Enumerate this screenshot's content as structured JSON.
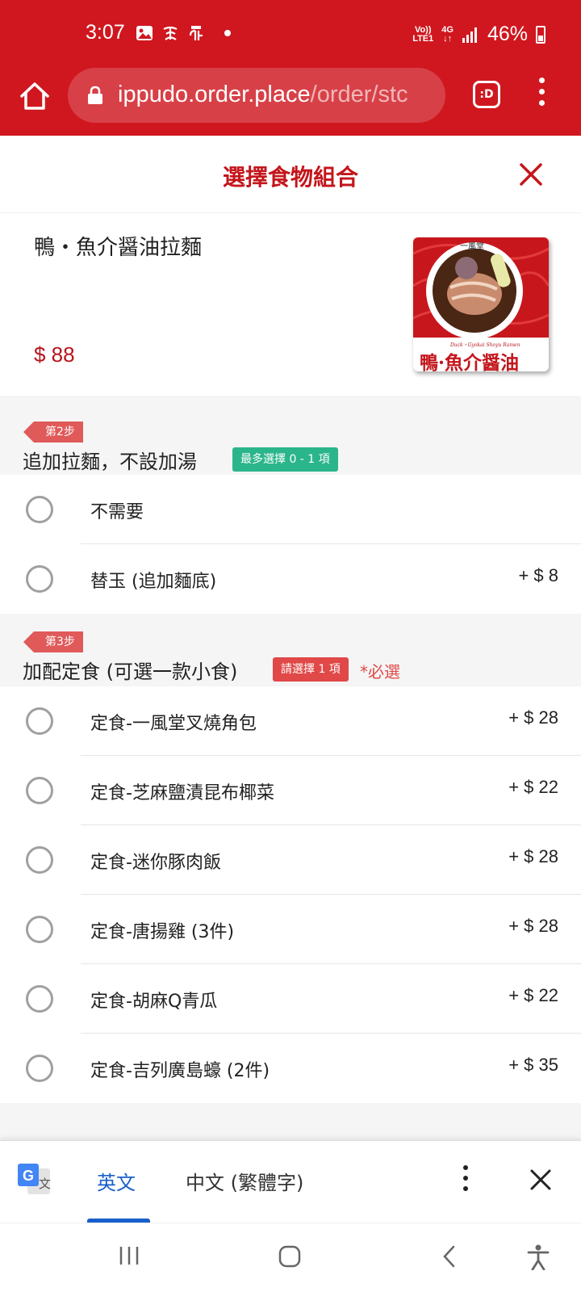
{
  "status": {
    "time": "3:07",
    "net_top": "Vo))",
    "net_bottom": "LTE1",
    "gen_top": "4G",
    "gen_bottom": "↓↑",
    "battery": "46%"
  },
  "browser": {
    "url_host": "ippudo.order.place",
    "url_path": "/order/stc",
    "tab_label": ":D"
  },
  "modal": {
    "title": "選擇食物組合"
  },
  "product": {
    "name": "鴨・魚介醤油拉麵",
    "price": "$ 88",
    "image_logo": "一風堂",
    "image_caption_en": "Duck・Gyokai Shoyu Ramen",
    "image_caption_zh": "鴨·魚介醤油"
  },
  "sections": [
    {
      "step": "第2步",
      "title": "追加拉麵，不設加湯",
      "badge": "最多選擇 0 - 1 項",
      "required": "",
      "options": [
        {
          "label": "不需要",
          "price": ""
        },
        {
          "label": "替玉 (追加麵底)",
          "price": "+ $ 8"
        }
      ]
    },
    {
      "step": "第3步",
      "title": "加配定食 (可選一款小食)",
      "badge": "請選擇 1 項",
      "required": "*必選",
      "options": [
        {
          "label": "定食-一風堂叉燒角包",
          "price": "+ $ 28"
        },
        {
          "label": "定食-芝麻鹽漬昆布椰菜",
          "price": "+ $ 22"
        },
        {
          "label": "定食-迷你豚肉飯",
          "price": "+ $ 28"
        },
        {
          "label": "定食-唐揚雞 (3件)",
          "price": "+ $ 28"
        },
        {
          "label": "定食-胡麻Q青瓜",
          "price": "+ $ 22"
        },
        {
          "label": "定食-吉列廣島蠔 (2件)",
          "price": "+ $ 35"
        }
      ]
    }
  ],
  "translate": {
    "tab_english": "英文",
    "tab_chinese": "中文 (繁體字)"
  },
  "colors": {
    "brand_red": "#d0171f",
    "accent_blue": "#1a5fcc",
    "badge_green": "#2bb58b",
    "badge_red": "#e14848"
  }
}
